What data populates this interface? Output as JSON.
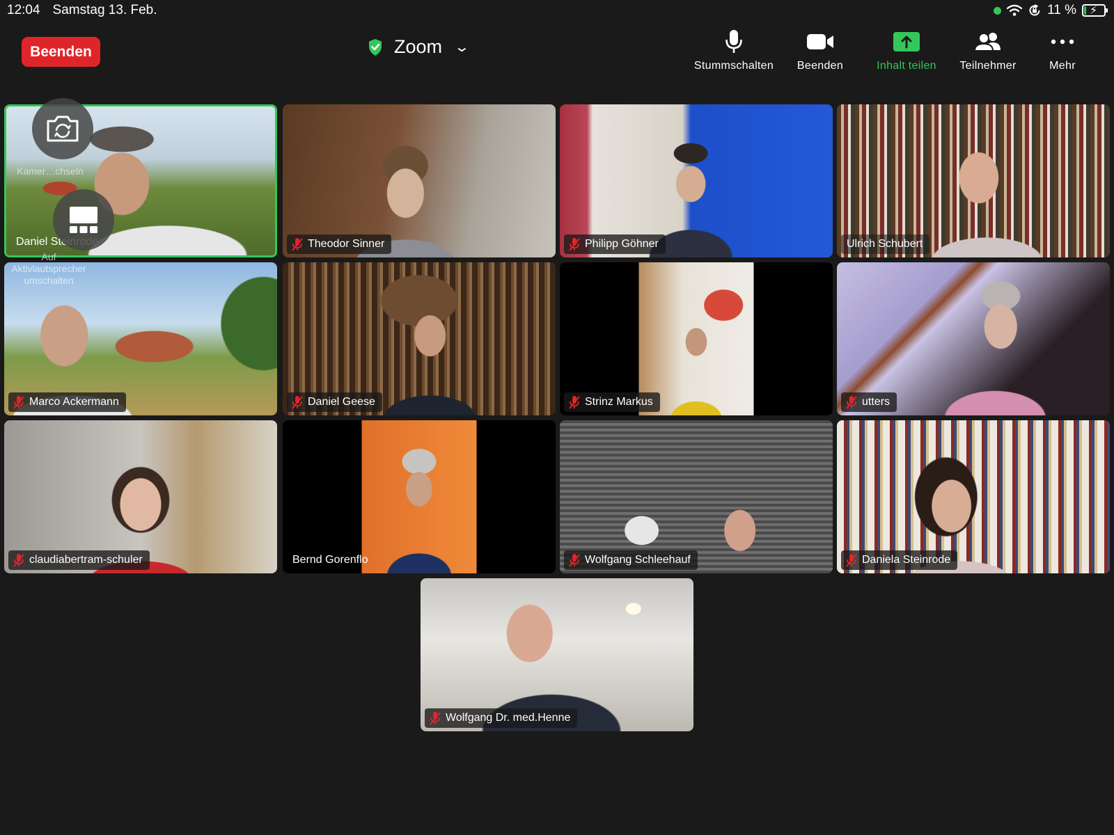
{
  "status_bar": {
    "time": "12:04",
    "date": "Samstag 13. Feb.",
    "battery": "11 %",
    "battery_level": 0.11,
    "icons": [
      "green-dot-indicator",
      "wifi-icon",
      "orientation-lock-icon",
      "battery-charging-icon"
    ]
  },
  "meeting": {
    "end_label": "Beenden",
    "title": "Zoom",
    "secure_icon": "shield-check-icon"
  },
  "toolbar": {
    "mute_label": "Stummschalten",
    "video_label": "Beenden",
    "share_label": "Inhalt teilen",
    "participants_label": "Teilnehmer",
    "more_label": "Mehr"
  },
  "self_view": {
    "camera_switch_label": "Kamer…chseln",
    "speaker_view_label": "Auf Aktivlautsprecher umschalten"
  },
  "participants": [
    {
      "name": "Daniel Steinrode",
      "muted": false,
      "active": true
    },
    {
      "name": "Theodor Sinner",
      "muted": true
    },
    {
      "name": "Philipp Göhner",
      "muted": true
    },
    {
      "name": "Ulrich Schubert",
      "muted": false
    },
    {
      "name": "Marco Ackermann",
      "muted": true
    },
    {
      "name": "Daniel Geese",
      "muted": true
    },
    {
      "name": "Strinz Markus",
      "muted": true
    },
    {
      "name": "utters",
      "muted": true
    },
    {
      "name": "claudiabertram-schuler",
      "muted": true
    },
    {
      "name": "Bernd Gorenflo",
      "muted": false
    },
    {
      "name": "Wolfgang Schleehauf",
      "muted": true
    },
    {
      "name": "Daniela Steinrode",
      "muted": true
    },
    {
      "name": "Wolfgang Dr. med.Henne",
      "muted": true
    }
  ],
  "colors": {
    "background": "#1a1a1a",
    "end_button": "#e0252a",
    "accent_green": "#34c759",
    "mute_red": "#e0252a"
  }
}
